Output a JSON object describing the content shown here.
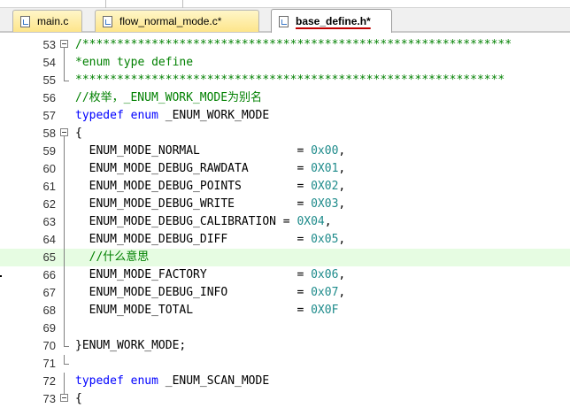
{
  "tabs": [
    {
      "label": "main.c",
      "active": false
    },
    {
      "label": "flow_normal_mode.c*",
      "active": false
    },
    {
      "label": "base_define.h*",
      "active": true
    }
  ],
  "lines": [
    {
      "n": "53",
      "hl": false,
      "segs": [
        {
          "t": "/**************************************************************",
          "c": "com"
        }
      ]
    },
    {
      "n": "54",
      "hl": false,
      "segs": [
        {
          "t": "*enum type define",
          "c": "com"
        }
      ]
    },
    {
      "n": "55",
      "hl": false,
      "segs": [
        {
          "t": "**************************************************************",
          "c": "com"
        }
      ]
    },
    {
      "n": "56",
      "hl": false,
      "segs": [
        {
          "t": "//枚举，_ENUM_WORK_MODE为别名",
          "c": "com"
        }
      ]
    },
    {
      "n": "57",
      "hl": false,
      "segs": [
        {
          "t": "typedef",
          "c": "kw"
        },
        {
          "t": " ",
          "c": ""
        },
        {
          "t": "enum",
          "c": "kw"
        },
        {
          "t": " _ENUM_WORK_MODE",
          "c": ""
        }
      ]
    },
    {
      "n": "58",
      "hl": false,
      "segs": [
        {
          "t": "{",
          "c": ""
        }
      ]
    },
    {
      "n": "59",
      "hl": false,
      "segs": [
        {
          "t": "  ENUM_MODE_NORMAL              = ",
          "c": ""
        },
        {
          "t": "0x00",
          "c": "num"
        },
        {
          "t": ",",
          "c": ""
        }
      ]
    },
    {
      "n": "60",
      "hl": false,
      "segs": [
        {
          "t": "  ENUM_MODE_DEBUG_RAWDATA       = ",
          "c": ""
        },
        {
          "t": "0X01",
          "c": "num"
        },
        {
          "t": ",",
          "c": ""
        }
      ]
    },
    {
      "n": "61",
      "hl": false,
      "segs": [
        {
          "t": "  ENUM_MODE_DEBUG_POINTS        = ",
          "c": ""
        },
        {
          "t": "0X02",
          "c": "num"
        },
        {
          "t": ",",
          "c": ""
        }
      ]
    },
    {
      "n": "62",
      "hl": false,
      "segs": [
        {
          "t": "  ENUM_MODE_DEBUG_WRITE         = ",
          "c": ""
        },
        {
          "t": "0X03",
          "c": "num"
        },
        {
          "t": ",",
          "c": ""
        }
      ]
    },
    {
      "n": "63",
      "hl": false,
      "segs": [
        {
          "t": "  ENUM_MODE_DEBUG_CALIBRATION = ",
          "c": ""
        },
        {
          "t": "0X04",
          "c": "num"
        },
        {
          "t": ",",
          "c": ""
        }
      ]
    },
    {
      "n": "64",
      "hl": false,
      "segs": [
        {
          "t": "  ENUM_MODE_DEBUG_DIFF          = ",
          "c": ""
        },
        {
          "t": "0x05",
          "c": "num"
        },
        {
          "t": ",",
          "c": ""
        }
      ]
    },
    {
      "n": "65",
      "hl": true,
      "segs": [
        {
          "t": "  //什么意思",
          "c": "com"
        }
      ]
    },
    {
      "n": "66",
      "hl": false,
      "segs": [
        {
          "t": "  ENUM_MODE_FACTORY             = ",
          "c": ""
        },
        {
          "t": "0x06",
          "c": "num"
        },
        {
          "t": ",",
          "c": ""
        }
      ]
    },
    {
      "n": "67",
      "hl": false,
      "segs": [
        {
          "t": "  ENUM_MODE_DEBUG_INFO          = ",
          "c": ""
        },
        {
          "t": "0x07",
          "c": "num"
        },
        {
          "t": ",",
          "c": ""
        }
      ]
    },
    {
      "n": "68",
      "hl": false,
      "segs": [
        {
          "t": "  ENUM_MODE_TOTAL               = ",
          "c": ""
        },
        {
          "t": "0X0F",
          "c": "num"
        }
      ]
    },
    {
      "n": "69",
      "hl": false,
      "segs": []
    },
    {
      "n": "70",
      "hl": false,
      "segs": [
        {
          "t": "}ENUM_WORK_MODE;",
          "c": ""
        }
      ]
    },
    {
      "n": "71",
      "hl": false,
      "segs": []
    },
    {
      "n": "72",
      "hl": false,
      "segs": [
        {
          "t": "typedef",
          "c": "kw"
        },
        {
          "t": " ",
          "c": ""
        },
        {
          "t": "enum",
          "c": "kw"
        },
        {
          "t": " _ENUM_SCAN_MODE",
          "c": ""
        }
      ]
    },
    {
      "n": "73",
      "hl": false,
      "segs": [
        {
          "t": "{",
          "c": ""
        }
      ]
    }
  ],
  "colors": {
    "comment": "#008000",
    "keyword": "#0000ff",
    "number": "#1e8b8b",
    "current_line": "#e6fce2"
  }
}
